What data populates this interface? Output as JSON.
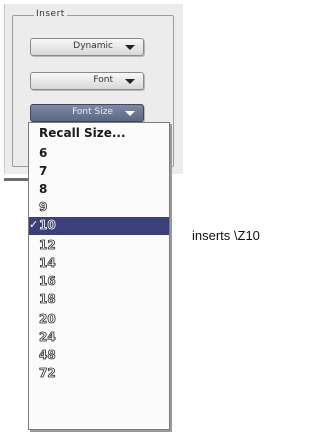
{
  "group": {
    "title": "Insert"
  },
  "popups": [
    {
      "name": "dynamic",
      "label": "Dynamic"
    },
    {
      "name": "font",
      "label": "Font"
    },
    {
      "name": "font-size",
      "label": "Font Size"
    }
  ],
  "menu": {
    "items": [
      "Recall Size...",
      "6",
      "7",
      "8",
      "9",
      "10",
      "12",
      "14",
      "16",
      "18",
      "20",
      "24",
      "48",
      "72"
    ],
    "selected": "10",
    "check_glyph": "✓"
  },
  "caption": "inserts \\Z10"
}
